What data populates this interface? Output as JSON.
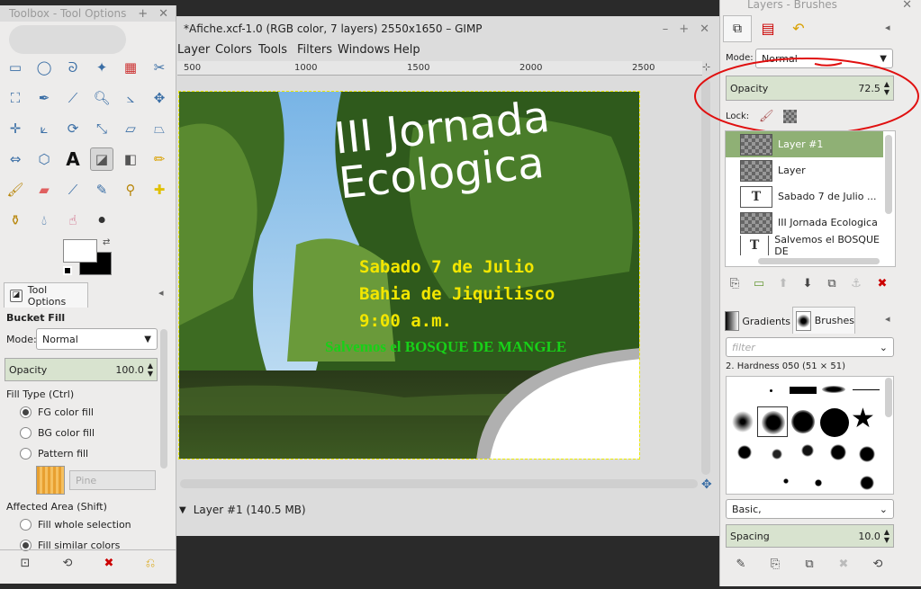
{
  "toolbox": {
    "title": "Toolbox - Tool Options",
    "tool_options_tab": "Tool Options",
    "tool_name": "Bucket Fill",
    "mode_label": "Mode:",
    "mode_value": "Normal",
    "opacity_label": "Opacity",
    "opacity_value": "100.0",
    "fill_type_label": "Fill Type  (Ctrl)",
    "fill_options": [
      "FG color fill",
      "BG color fill",
      "Pattern fill"
    ],
    "pattern_name": "Pine",
    "affected_area_label": "Affected Area  (Shift)",
    "affected_options": [
      "Fill whole selection",
      "Fill similar colors"
    ]
  },
  "image_window": {
    "title": "*Afiche.xcf-1.0 (RGB color, 7 layers) 2550x1650 – GIMP",
    "menus": [
      "Layer",
      "Colors",
      "Tools",
      "Filters",
      "Windows",
      "Help"
    ],
    "ruler_ticks": [
      "500",
      "1000",
      "1500",
      "2000",
      "2500"
    ],
    "status": "Layer #1 (140.5 MB)"
  },
  "poster": {
    "title_line1": "III Jornada",
    "title_line2": "Ecologica",
    "info_lines": [
      "Sabado 7 de Julio",
      "Bahia de Jiquilisco",
      "9:00 a.m."
    ],
    "slogan": "Salvemos el BOSQUE DE MANGLE"
  },
  "layers_dock": {
    "title": "Layers - Brushes",
    "mode_label": "Mode:",
    "mode_value": "Normal",
    "opacity_label": "Opacity",
    "opacity_value": "72.5",
    "lock_label": "Lock:",
    "layers": [
      "Layer #1",
      "Layer",
      "Sabado 7 de Julio ...",
      "III Jornada Ecologica",
      "Salvemos el BOSQUE DE"
    ],
    "tabs": [
      "Gradients",
      "Brushes"
    ],
    "filter_placeholder": "filter",
    "brush_name": "2. Hardness 050 (51 × 51)",
    "brush_set": "Basic,",
    "spacing_label": "Spacing",
    "spacing_value": "10.0"
  },
  "colors": {
    "accent": "#d8e3cf",
    "annotation": "#e01010",
    "active_layer": "#8fb075"
  }
}
